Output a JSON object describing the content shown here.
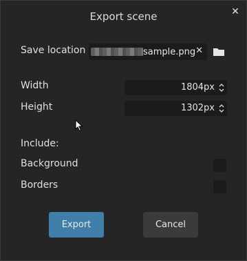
{
  "dialog": {
    "title": "Export scene",
    "close_glyph": "✕"
  },
  "save_location": {
    "label": "Save location",
    "file_name": "sample.png",
    "clear_glyph": "✕",
    "folder_icon": "folder-icon"
  },
  "width": {
    "label": "Width",
    "value": "1804px"
  },
  "height": {
    "label": "Height",
    "value": "1302px"
  },
  "include": {
    "label": "Include:",
    "background_label": "Background",
    "background_checked": false,
    "borders_label": "Borders",
    "borders_checked": false
  },
  "buttons": {
    "export_label": "Export",
    "cancel_label": "Cancel"
  },
  "colors": {
    "accent": "#3f7fa9",
    "background": "#252525",
    "field": "#1b1b1b",
    "secondary_button": "#3b3b3b"
  }
}
